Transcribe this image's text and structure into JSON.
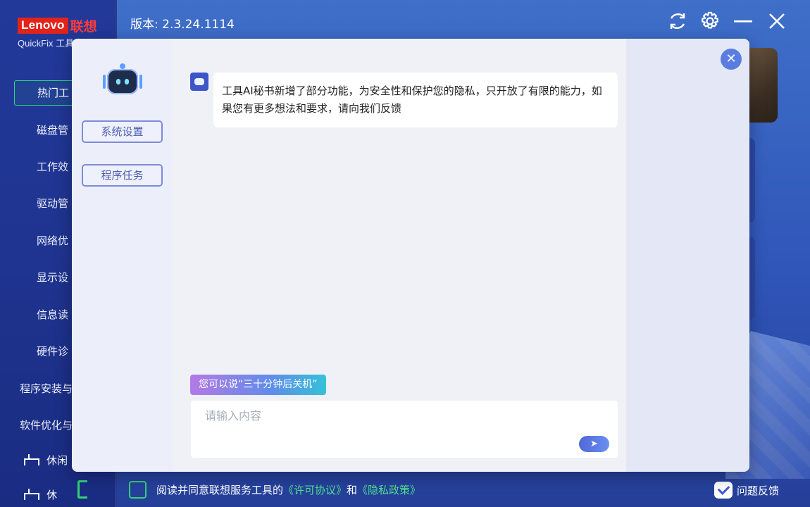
{
  "app": {
    "logo_brand": "Lenovo",
    "logo_brand_cn": "联想",
    "logo_sub": "QuickFix 工具中心",
    "version_label": "版本: 2.3.24.1114"
  },
  "titlebar": {
    "icons": [
      "refresh-icon",
      "gear-icon",
      "minimize-icon",
      "close-icon"
    ]
  },
  "sidebar": {
    "active_item": "热门工",
    "sub_items": [
      "磁盘管",
      "工作效",
      "驱动管",
      "网络优",
      "显示设",
      "信息读",
      "硬件诊"
    ],
    "top_items": [
      "程序安装与",
      "软件优化与"
    ],
    "bottom_items": [
      "休闲",
      "休"
    ]
  },
  "modal": {
    "side_buttons": [
      "系统设置",
      "程序任务"
    ],
    "assistant_message": "工具AI秘书新增了部分功能，为安全性和保护您的隐私，只开放了有限的能力，如果您有更多想法和要求，请向我们反馈",
    "hint_chip": "您可以说“三十分钟后关机”",
    "input_placeholder": "请输入内容",
    "close_symbol": "✕",
    "send_symbol": "➤"
  },
  "footer": {
    "agree_prefix": "阅读并同意联想服务工具的",
    "license_link": "《许可协议》",
    "and_text": "和",
    "privacy_link": "《隐私政策》",
    "feedback_label": "问题反馈"
  },
  "colors": {
    "accent_green": "#32d27a",
    "brand_red": "#e2231a",
    "modal_button_border": "#7e8bd8"
  }
}
